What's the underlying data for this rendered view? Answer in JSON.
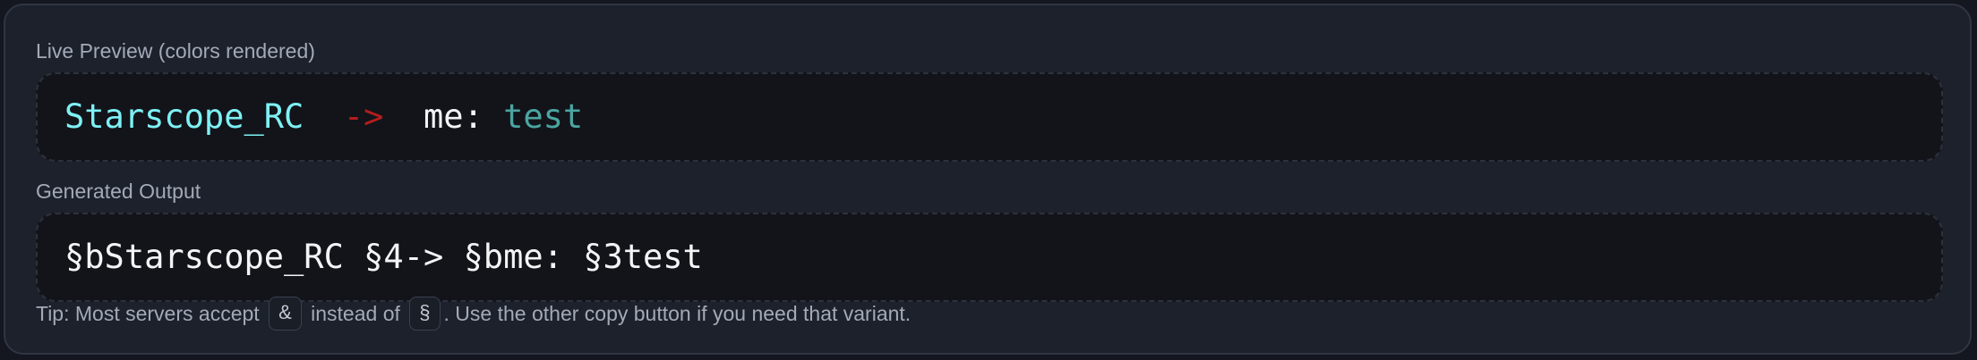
{
  "preview": {
    "label": "Live Preview (colors rendered)",
    "segments": [
      {
        "text": "Starscope_RC",
        "color": "#7ef1f4"
      },
      {
        "text": "->",
        "color": "#b51d1d"
      },
      {
        "text": "me:",
        "color": "#f3f4f6"
      },
      {
        "text": "test",
        "color": "#4ba5a1"
      }
    ]
  },
  "output": {
    "label": "Generated Output",
    "text": "§bStarscope_RC §4-> §bme: §3test"
  },
  "tip": {
    "before": "Tip: Most servers accept",
    "ampersand": "&",
    "middle": "instead of",
    "section_sign": "§",
    "after": ". Use the other copy button if you need that variant."
  }
}
